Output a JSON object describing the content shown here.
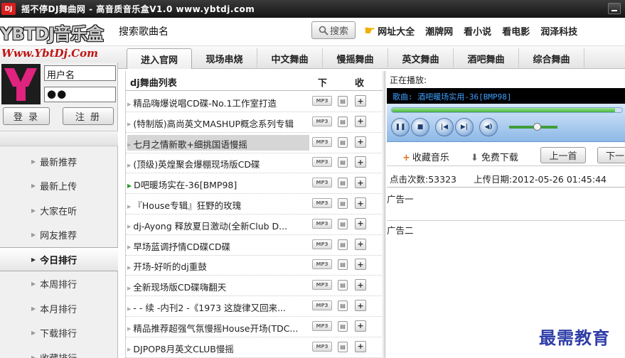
{
  "window": {
    "logo": "DJ",
    "title": "摇不停DJ舞曲网 - 高音质音乐盒V1.0  www.ybtdj.com"
  },
  "header": {
    "logo_text": "YBTDJ音乐盒",
    "site_url": "Www.YbtDj.Com",
    "search_placeholder": "搜索歌曲名",
    "search_button": "搜索",
    "links": [
      "网址大全",
      "潮牌网",
      "看小说",
      "看电影",
      "润泽科技"
    ]
  },
  "tabs": [
    "进入官网",
    "现场串烧",
    "中文舞曲",
    "慢摇舞曲",
    "英文舞曲",
    "酒吧舞曲",
    "综合舞曲"
  ],
  "login": {
    "username_placeholder": "用户名",
    "password_value": "●●",
    "login_button": "登 录",
    "register_button": "注 册"
  },
  "sidebar": {
    "items": [
      "最新推荐",
      "最新上传",
      "大家在听",
      "网友推荐",
      "今日排行",
      "本周排行",
      "本月排行",
      "下载排行",
      "收藏排行"
    ],
    "active": "今日排行"
  },
  "song_list": {
    "header": {
      "title": "dj舞曲列表",
      "download": "下",
      "favorite": "收"
    },
    "mp3_label": "MP3",
    "songs": [
      "精品嗨爆说唱CD碟-No.1工作室打造",
      "(特制版)高尚英文MASHUP概念系列专辑",
      "七月之情新歌+细挑国语慢摇",
      "(顶级)英煌聚会爆棚现场版CD碟",
      "D吧暖场实在-36[BMP98]",
      "『House专辑』狂野的玫瑰",
      "dj-Ayong 释放夏日激动(全新Club D...",
      "早场蓝调抒情CD碟CD碟",
      "开场-好听的dj重鼓",
      "全新现场版CD碟嗨翻天",
      "- - 续 -内刊2 -《1973 这旋律又回来...",
      "精品推荐超强气氛慢摇House开场(TDC...",
      "DJPOP8月英文CLUB慢摇"
    ],
    "highlighted_index": 2,
    "playing_index": 4
  },
  "player": {
    "now_playing_label": "正在播放:",
    "now_playing": "歌曲: 酒吧暖场实用-36[BMP98]",
    "progress": 0.97,
    "volume": 0.5,
    "controls": [
      "pause",
      "stop",
      "previous",
      "next",
      "mute"
    ],
    "favorite_button": "收藏音乐",
    "download_button": "免费下载",
    "prev_button": "上一首",
    "next_button": "下一",
    "plays": "点击次数:53323",
    "upload_date": "上传日期:2012-05-26 01:45:44",
    "ad1": "广告一",
    "ad2": "广告二"
  },
  "watermark": "最需教育"
}
